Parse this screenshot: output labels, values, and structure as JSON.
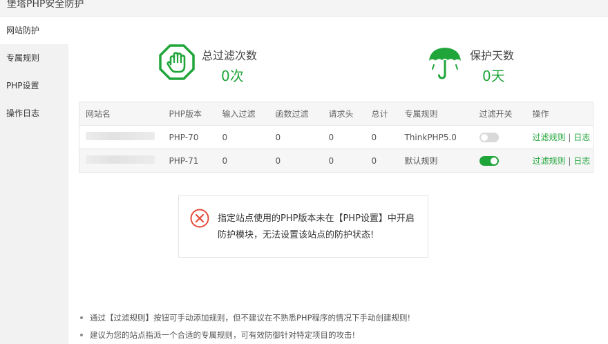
{
  "window": {
    "title": "堡塔PHP安全防护"
  },
  "sidebar": {
    "items": [
      {
        "label": "网站防护"
      },
      {
        "label": "专属规则"
      },
      {
        "label": "PHP设置"
      },
      {
        "label": "操作日志"
      }
    ]
  },
  "stats": {
    "filter": {
      "label": "总过滤次数",
      "value": "0次",
      "icon": "stop-hand-icon"
    },
    "protect": {
      "label": "保护天数",
      "value": "0天",
      "icon": "umbrella-icon"
    }
  },
  "table": {
    "headers": [
      "网站名",
      "PHP版本",
      "输入过滤",
      "函数过滤",
      "请求头",
      "总计",
      "专属规则",
      "过滤开关",
      "操作"
    ],
    "rows": [
      {
        "php": "PHP-70",
        "input": "0",
        "func": "0",
        "header": "0",
        "total": "0",
        "rule": "ThinkPHP5.0",
        "switch": false,
        "action_rules": "过滤规则",
        "action_sep": "|",
        "action_log": "日志"
      },
      {
        "php": "PHP-71",
        "input": "0",
        "func": "0",
        "header": "0",
        "total": "0",
        "rule": "默认规则",
        "switch": true,
        "action_rules": "过滤规则",
        "action_sep": "|",
        "action_log": "日志"
      }
    ]
  },
  "alert": {
    "message": "指定站点使用的PHP版本未在【PHP设置】中开启防护模块，无法设置该站点的防护状态!"
  },
  "tips": [
    "通过【过滤规则】按钮可手动添加规则，但不建议在不熟悉PHP程序的情况下手动创建规则!",
    "建议为您的站点指派一个合适的专属规则，可有效防御针对特定项目的攻击!"
  ],
  "colors": {
    "accent": "#20a53a",
    "danger": "#e74c3c"
  }
}
